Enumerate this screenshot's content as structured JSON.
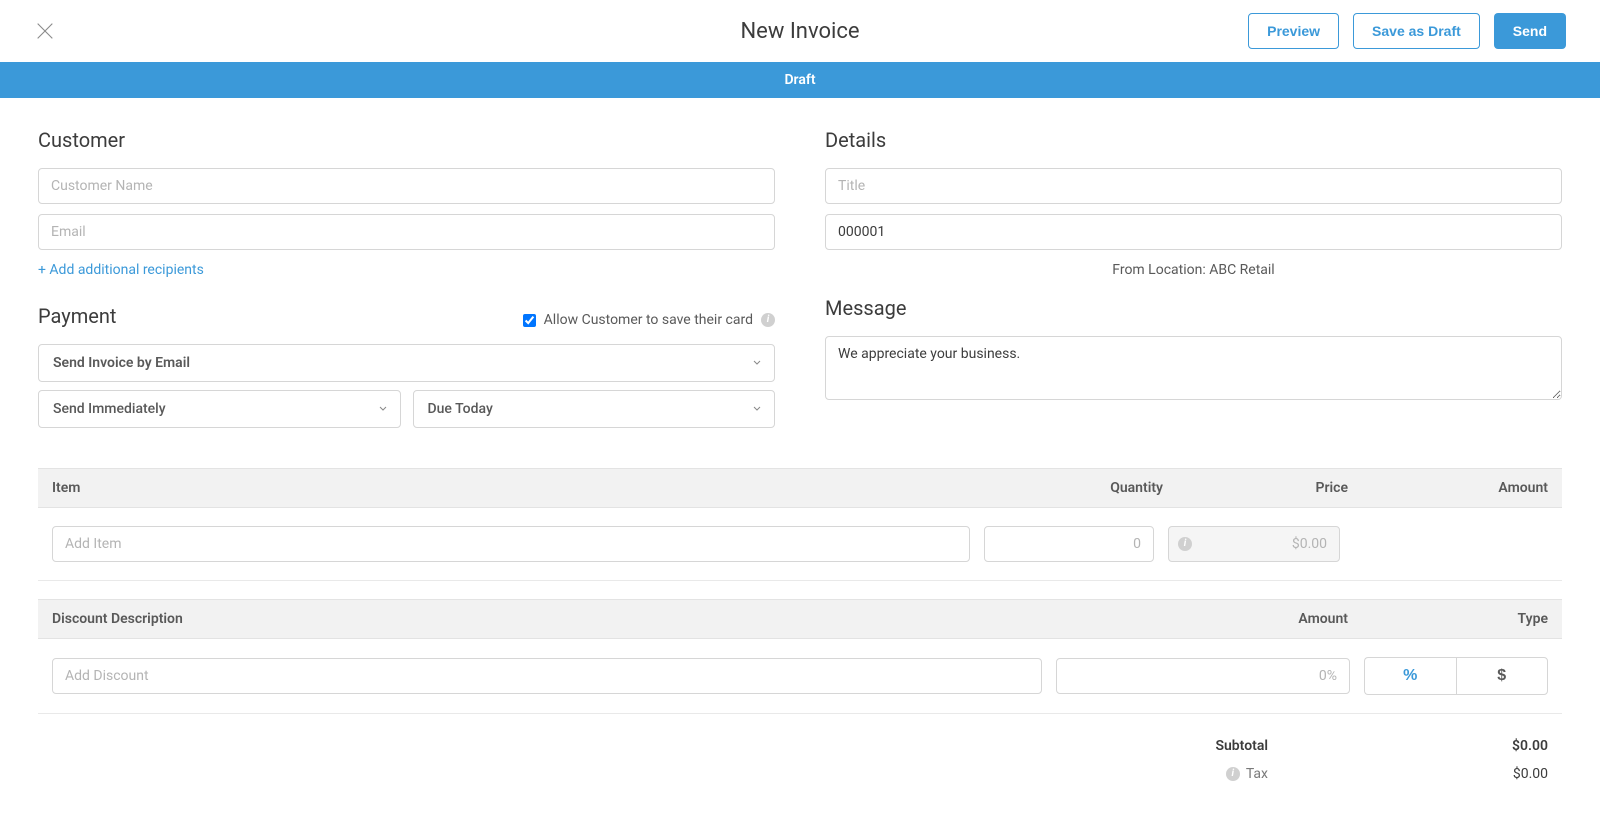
{
  "header": {
    "title": "New Invoice",
    "preview": "Preview",
    "save_draft": "Save as Draft",
    "send": "Send"
  },
  "banner": {
    "status": "Draft"
  },
  "customer": {
    "heading": "Customer",
    "name_placeholder": "Customer Name",
    "email_placeholder": "Email",
    "add_recipients": "+ Add additional recipients"
  },
  "payment": {
    "heading": "Payment",
    "allow_save_card": "Allow Customer to save their card",
    "method": "Send Invoice by Email",
    "send_when": "Send Immediately",
    "due": "Due Today"
  },
  "details": {
    "heading": "Details",
    "title_placeholder": "Title",
    "number_value": "000001",
    "from_location": "From Location: ABC Retail"
  },
  "message": {
    "heading": "Message",
    "value": "We appreciate your business."
  },
  "items_table": {
    "cols": {
      "item": "Item",
      "qty": "Quantity",
      "price": "Price",
      "amount": "Amount"
    },
    "row": {
      "item_placeholder": "Add Item",
      "qty_placeholder": "0",
      "price_placeholder": "$0.00"
    }
  },
  "discount_table": {
    "cols": {
      "desc": "Discount Description",
      "amount": "Amount",
      "type": "Type"
    },
    "row": {
      "desc_placeholder": "Add Discount",
      "amount_placeholder": "0%",
      "type_percent": "%",
      "type_dollar": "$"
    }
  },
  "totals": {
    "subtotal_label": "Subtotal",
    "subtotal_value": "$0.00",
    "tax_label": "Tax",
    "tax_value": "$0.00"
  }
}
